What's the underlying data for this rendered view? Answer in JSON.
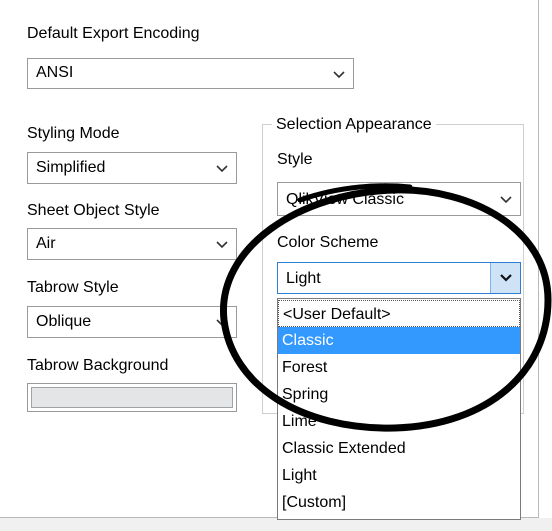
{
  "default_export_encoding": {
    "label": "Default Export Encoding",
    "value": "ANSI"
  },
  "styling_mode": {
    "label": "Styling Mode",
    "value": "Simplified"
  },
  "sheet_object_style": {
    "label": "Sheet Object Style",
    "value": "Air"
  },
  "tabrow_style": {
    "label": "Tabrow Style",
    "value": "Oblique"
  },
  "tabrow_background": {
    "label": "Tabrow Background",
    "color": "#e3e5e6"
  },
  "selection_appearance": {
    "title": "Selection Appearance",
    "style_label": "Style",
    "style_value": "QlikView Classic",
    "color_scheme_label": "Color Scheme",
    "color_scheme_value": "Light",
    "options": [
      "<User Default>",
      "Classic",
      "Forest",
      "Spring",
      "Lime",
      "Classic Extended",
      "Light",
      "[Custom]"
    ],
    "highlighted_option": "Classic"
  },
  "colors": {
    "highlight": "#3399ff",
    "annotation": "#000000"
  }
}
